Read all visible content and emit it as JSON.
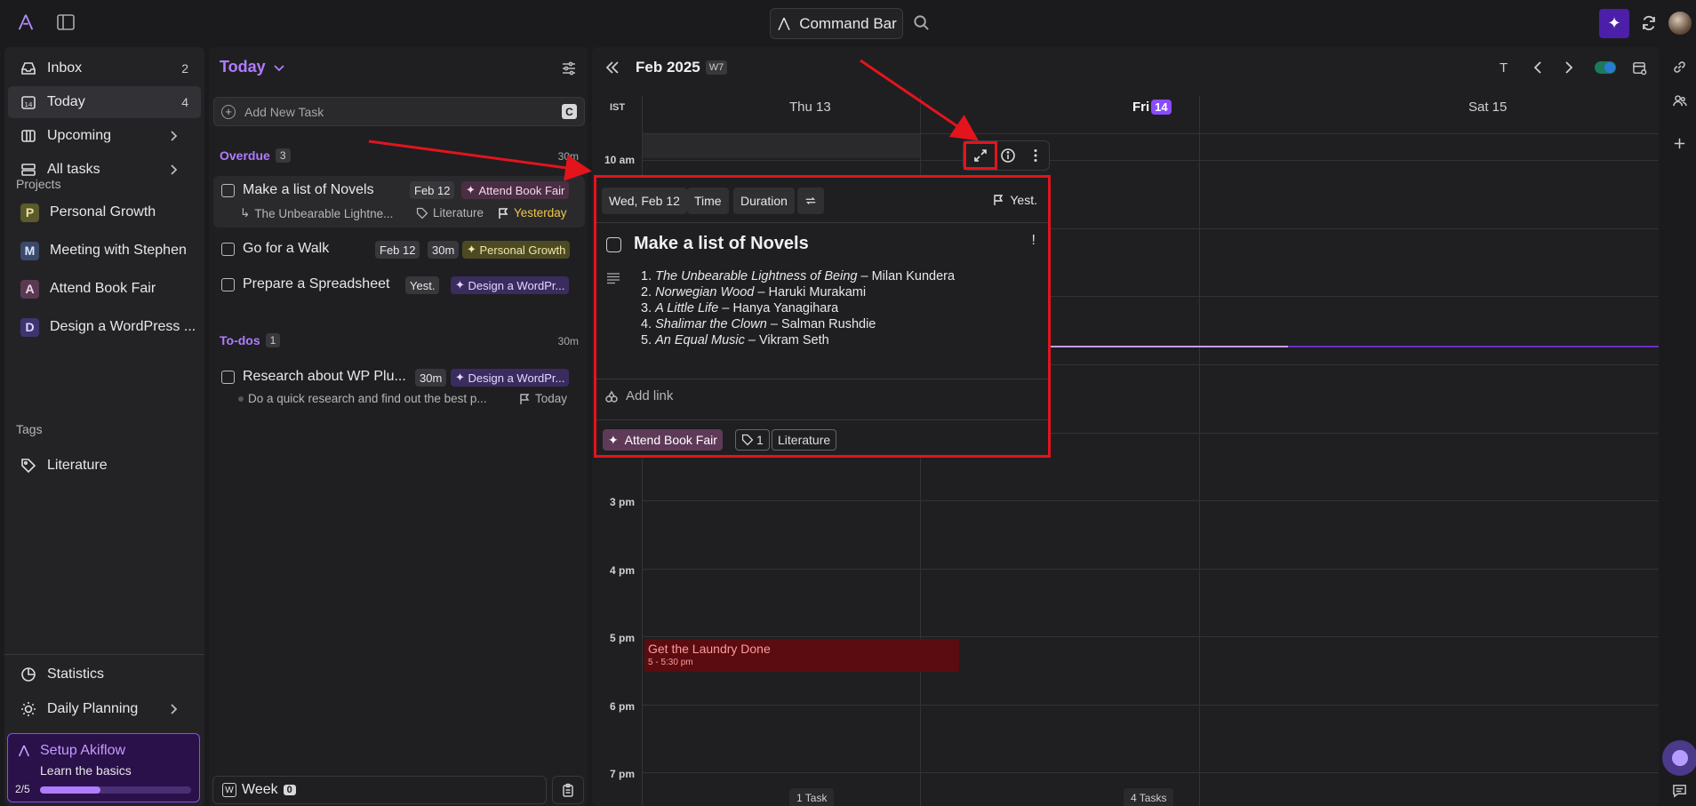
{
  "topbar": {
    "command_bar_label": "Command Bar"
  },
  "sidebar": {
    "nav": [
      {
        "label": "Inbox",
        "count": "2"
      },
      {
        "label": "Today",
        "count": "4"
      },
      {
        "label": "Upcoming"
      },
      {
        "label": "All tasks"
      }
    ],
    "projects_label": "Projects",
    "projects": [
      {
        "initial": "P",
        "label": "Personal Growth",
        "color": "#5a5a2a"
      },
      {
        "initial": "M",
        "label": "Meeting with Stephen",
        "color": "#3a4a6a"
      },
      {
        "initial": "A",
        "label": "Attend Book Fair",
        "color": "#5a3a52"
      },
      {
        "initial": "D",
        "label": "Design a WordPress ...",
        "color": "#3e3570"
      }
    ],
    "tags_label": "Tags",
    "tags": [
      {
        "label": "Literature"
      }
    ],
    "bottom": [
      {
        "label": "Statistics"
      },
      {
        "label": "Daily Planning"
      }
    ],
    "setup": {
      "title": "Setup Akiflow",
      "subtitle": "Learn the basics",
      "progress_label": "2/5",
      "progress": 0.4
    }
  },
  "today": {
    "title": "Today",
    "add_task_placeholder": "Add New Task",
    "add_task_shortcut": "C",
    "overdue": {
      "label": "Overdue",
      "count": "3",
      "duration": "30m",
      "tasks": [
        {
          "name": "Make a list of Novels",
          "date": "Feb 12",
          "project": "Attend Book Fair",
          "note": "The Unbearable Lightne...",
          "tag": "Literature",
          "due": "Yesterday"
        },
        {
          "name": "Go for a Walk",
          "date": "Feb 12",
          "duration": "30m",
          "project": "Personal Growth"
        },
        {
          "name": "Prepare a Spreadsheet",
          "date": "Yest.",
          "project": "Design a WordPr..."
        }
      ]
    },
    "todos": {
      "label": "To-dos",
      "count": "1",
      "duration": "30m",
      "tasks": [
        {
          "name": "Research about WP Plu...",
          "duration": "30m",
          "project": "Design a WordPr...",
          "note": "Do a quick research and find out the best p...",
          "due": "Today"
        }
      ]
    },
    "week_label": "Week",
    "week_count": "0"
  },
  "calendar": {
    "title": "Feb 2025",
    "week_badge": "W7",
    "view_letter": "T",
    "timezone": "IST",
    "days": [
      {
        "label": "Thu 13"
      },
      {
        "label": "Fri",
        "num": "14"
      },
      {
        "label": "Sat 15"
      }
    ],
    "hours": [
      "3 pm",
      "4 pm",
      "5 pm",
      "6 pm",
      "7 pm"
    ],
    "partial_hour": "10 am",
    "event": {
      "title": "Get the Laundry Done",
      "time": "5 - 5:30 pm",
      "color": "#5a0c10"
    },
    "footer": [
      {
        "label": "1 Task"
      },
      {
        "label": "4 Tasks"
      }
    ]
  },
  "popup": {
    "date": "Wed, Feb 12",
    "time_label": "Time",
    "duration_label": "Duration",
    "deadline": "Yest.",
    "title": "Make a list of Novels",
    "priority": "!",
    "notes": [
      {
        "num": "1.",
        "book": "The Unbearable Lightness of Being",
        "author": "– Milan Kundera"
      },
      {
        "num": "2.",
        "book": "Norwegian Wood",
        "author": "– Haruki Murakami"
      },
      {
        "num": "3.",
        "book": "A Little Life",
        "author": "– Hanya Yanagihara"
      },
      {
        "num": "4.",
        "book": "Shalimar the Clown",
        "author": "– Salman Rushdie"
      },
      {
        "num": "5.",
        "book": "An Equal Music",
        "author": "– Vikram Seth"
      }
    ],
    "add_link_label": "Add link",
    "project": "Attend Book Fair",
    "tag_count": "1",
    "tag": "Literature"
  },
  "colors": {
    "accent": "#b07cff",
    "highlight": "#e3141c",
    "background": "#1b1b1d"
  }
}
